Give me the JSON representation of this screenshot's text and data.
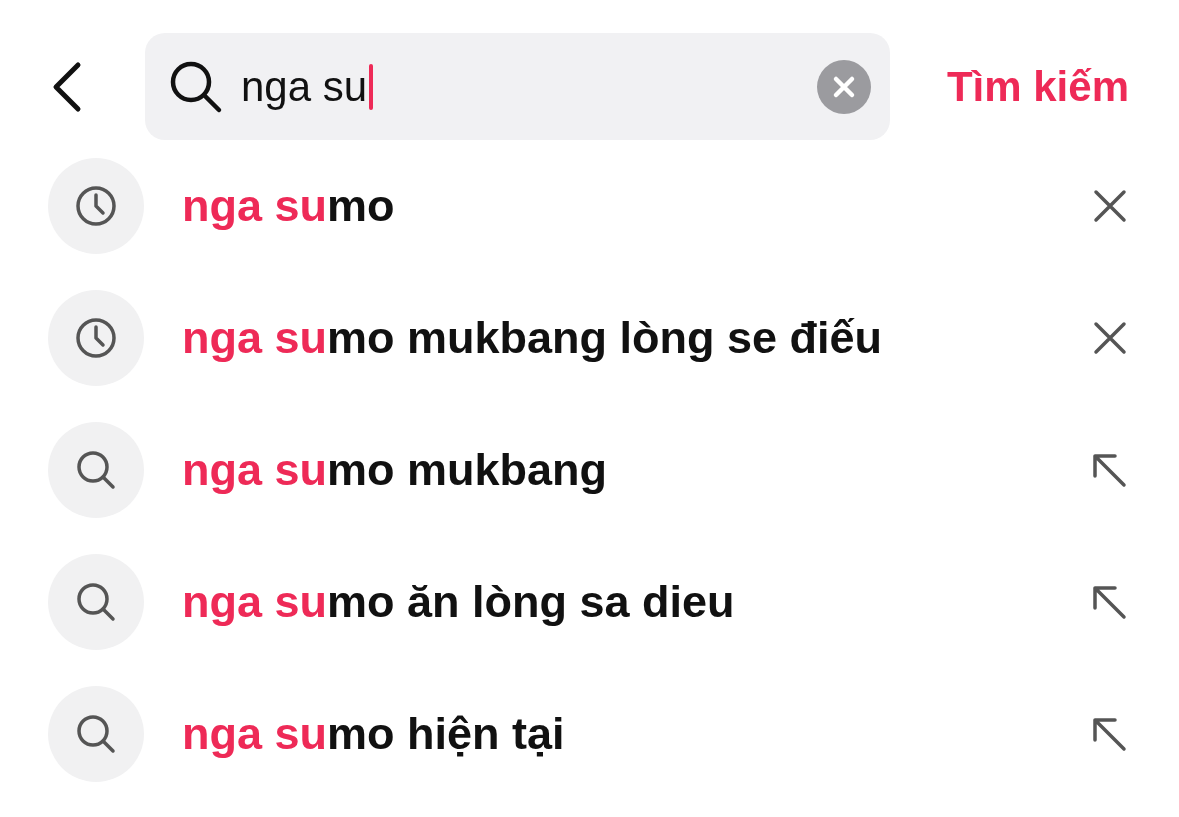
{
  "search": {
    "value": "nga su",
    "action": "Tìm kiếm"
  },
  "suggestions": [
    {
      "kind": "history",
      "match": "nga su",
      "rest": "mo"
    },
    {
      "kind": "history",
      "match": "nga su",
      "rest": "mo mukbang lòng se điếu"
    },
    {
      "kind": "suggestion",
      "match": "nga su",
      "rest": "mo mukbang"
    },
    {
      "kind": "suggestion",
      "match": "nga su",
      "rest": "mo ăn lòng sa dieu"
    },
    {
      "kind": "suggestion",
      "match": "nga su",
      "rest": "mo hiện tại"
    }
  ]
}
